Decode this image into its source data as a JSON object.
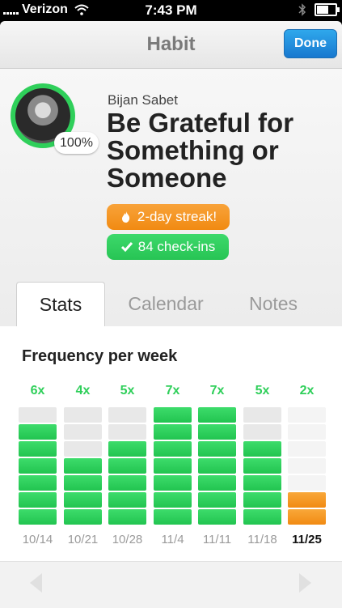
{
  "status": {
    "carrier": "Verizon",
    "time": "7:43 PM"
  },
  "nav": {
    "title": "Habit",
    "done_label": "Done"
  },
  "habit": {
    "owner": "Bijan Sabet",
    "title": "Be Grateful for Something or Someone",
    "completion": "100%",
    "streak": "2-day streak!",
    "checkins": "84 check-ins"
  },
  "tabs": [
    "Stats",
    "Calendar",
    "Notes"
  ],
  "stats": {
    "title": "Frequency per week",
    "colors": {
      "done": "#2fcf5a",
      "current": "#f18a12",
      "empty": "#e8e8e8"
    },
    "weeks": [
      {
        "label": "10/14",
        "count": "6x",
        "value": 6
      },
      {
        "label": "10/21",
        "count": "4x",
        "value": 4
      },
      {
        "label": "10/28",
        "count": "5x",
        "value": 5
      },
      {
        "label": "11/4",
        "count": "7x",
        "value": 7
      },
      {
        "label": "11/11",
        "count": "7x",
        "value": 7
      },
      {
        "label": "11/18",
        "count": "5x",
        "value": 5
      },
      {
        "label": "11/25",
        "count": "2x",
        "value": 2,
        "current": true
      }
    ]
  },
  "chart_data": {
    "type": "bar",
    "title": "Frequency per week",
    "categories": [
      "10/14",
      "10/21",
      "10/28",
      "11/4",
      "11/11",
      "11/18",
      "11/25"
    ],
    "values": [
      6,
      4,
      5,
      7,
      7,
      5,
      2
    ],
    "ylim": [
      0,
      7
    ]
  }
}
